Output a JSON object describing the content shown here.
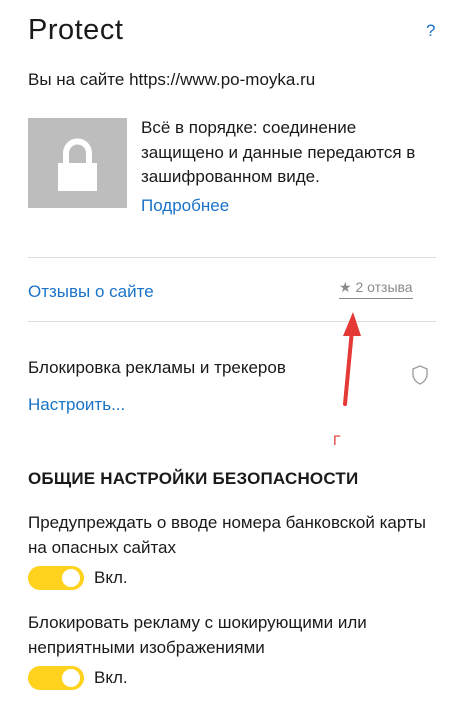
{
  "header": {
    "title": "Protect",
    "help_label": "?"
  },
  "site": {
    "text": "Вы на сайте https://www.po-moyka.ru"
  },
  "connection": {
    "status_text": "Всё в порядке: соединение защищено и данные передаются в зашифрованном виде.",
    "more_link": "Подробнее",
    "icon": "lock-icon"
  },
  "reviews": {
    "link_label": "Отзывы о сайте",
    "count_label": "2 отзыва",
    "icon": "star-icon"
  },
  "adblock": {
    "label": "Блокировка рекламы и трекеров",
    "configure_link": "Настроить...",
    "icon": "shield-icon"
  },
  "annotation": {
    "mark": "Г",
    "arrow_color": "#e53935"
  },
  "security": {
    "section_title": "ОБЩИЕ НАСТРОЙКИ БЕЗОПАСНОСТИ",
    "settings": [
      {
        "text": "Предупреждать о вводе номера банковской карты на опасных сайтах",
        "state_label": "Вкл.",
        "enabled": true
      },
      {
        "text": "Блокировать рекламу с шокирующими или неприятными изображениями",
        "state_label": "Вкл.",
        "enabled": true
      }
    ]
  },
  "colors": {
    "accent": "#1a73c9",
    "toggle_on": "#ffd21e",
    "annotation": "#e53935"
  }
}
